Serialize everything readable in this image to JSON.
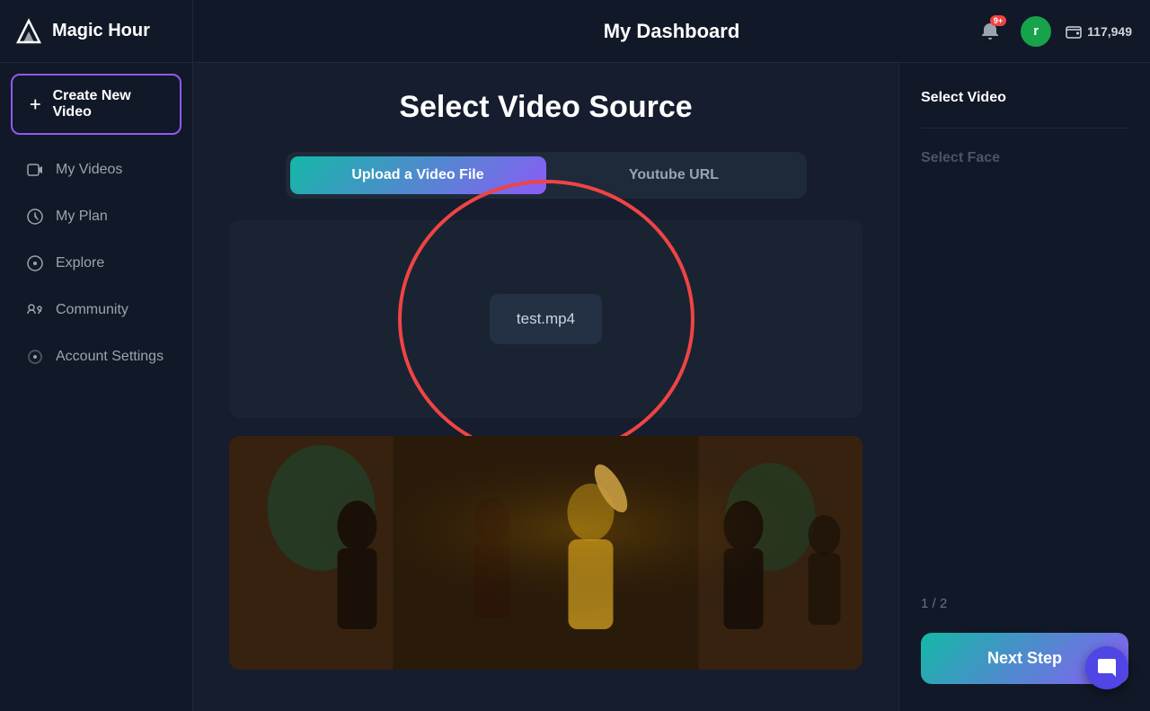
{
  "app": {
    "name": "Magic Hour",
    "page_title": "My Dashboard"
  },
  "sidebar": {
    "logo_text": "Magic Hour",
    "create_button": "Create New Video",
    "nav_items": [
      {
        "id": "my-videos",
        "label": "My Videos"
      },
      {
        "id": "my-plan",
        "label": "My Plan"
      },
      {
        "id": "explore",
        "label": "Explore"
      },
      {
        "id": "community",
        "label": "Community"
      },
      {
        "id": "account-settings",
        "label": "Account Settings"
      }
    ]
  },
  "topbar": {
    "title": "My Dashboard",
    "notif_badge": "9+",
    "user_initial": "r",
    "credits_icon": "wallet",
    "credits_value": "117,949"
  },
  "main": {
    "page_title": "Select Video Source",
    "tabs": [
      {
        "id": "upload",
        "label": "Upload a Video File",
        "active": true
      },
      {
        "id": "youtube",
        "label": "Youtube URL",
        "active": false
      }
    ],
    "file_name": "test.mp4"
  },
  "right_panel": {
    "steps": [
      {
        "id": "select-video",
        "label": "Select Video",
        "active": true
      },
      {
        "id": "select-face",
        "label": "Select Face",
        "active": false
      }
    ],
    "counter": "1 / 2",
    "next_step_label": "Next Step"
  },
  "chat": {
    "icon": "chat-icon"
  }
}
